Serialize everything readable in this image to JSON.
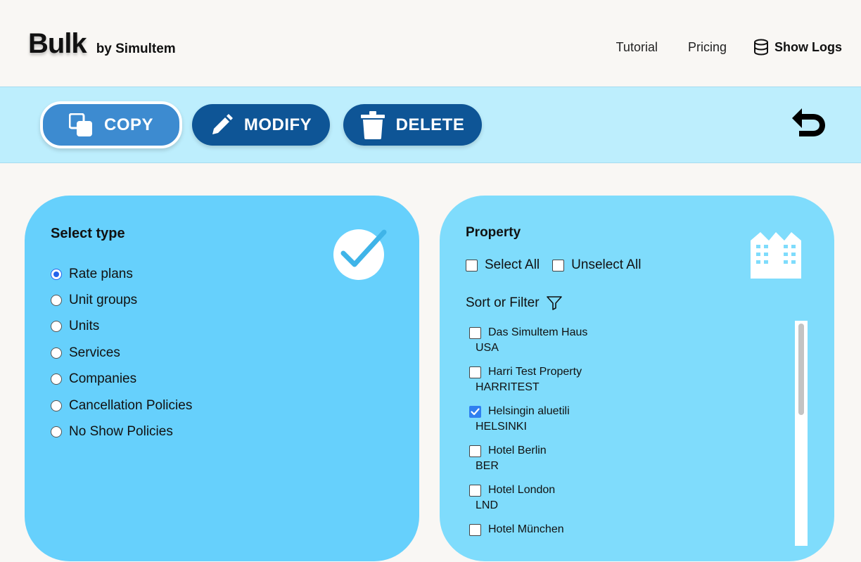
{
  "header": {
    "brand": "Bulk",
    "brand_sub": "by Simultem",
    "nav": {
      "tutorial": "Tutorial",
      "pricing": "Pricing",
      "show_logs": "Show Logs"
    }
  },
  "toolbar": {
    "copy_label": "COPY",
    "modify_label": "MODIFY",
    "delete_label": "DELETE",
    "selected": "COPY"
  },
  "type_panel": {
    "title": "Select type",
    "options": [
      {
        "label": "Rate plans",
        "checked": true
      },
      {
        "label": "Unit groups",
        "checked": false
      },
      {
        "label": "Units",
        "checked": false
      },
      {
        "label": "Services",
        "checked": false
      },
      {
        "label": "Companies",
        "checked": false
      },
      {
        "label": "Cancellation Policies",
        "checked": false
      },
      {
        "label": "No Show Policies",
        "checked": false
      }
    ]
  },
  "property_panel": {
    "title": "Property",
    "select_all": "Select All",
    "unselect_all": "Unselect All",
    "sort_filter": "Sort or Filter",
    "properties": [
      {
        "name": "Das Simultem Haus",
        "code": "USA",
        "checked": false
      },
      {
        "name": "Harri Test Property",
        "code": "HARRITEST",
        "checked": false
      },
      {
        "name": "Helsingin aluetili",
        "code": "HELSINKI",
        "checked": true
      },
      {
        "name": "Hotel Berlin",
        "code": "BER",
        "checked": false
      },
      {
        "name": "Hotel London",
        "code": "LND",
        "checked": false
      },
      {
        "name": "Hotel München",
        "code": "",
        "checked": false
      }
    ]
  },
  "colors": {
    "accent_dark": "#0e5596",
    "accent_selected": "#3d8bd0",
    "toolbar_bg": "#bdeefd",
    "panel_left": "#66d0fc",
    "panel_right": "#7fdcfc",
    "checkbox_checked": "#2f7ff0"
  }
}
